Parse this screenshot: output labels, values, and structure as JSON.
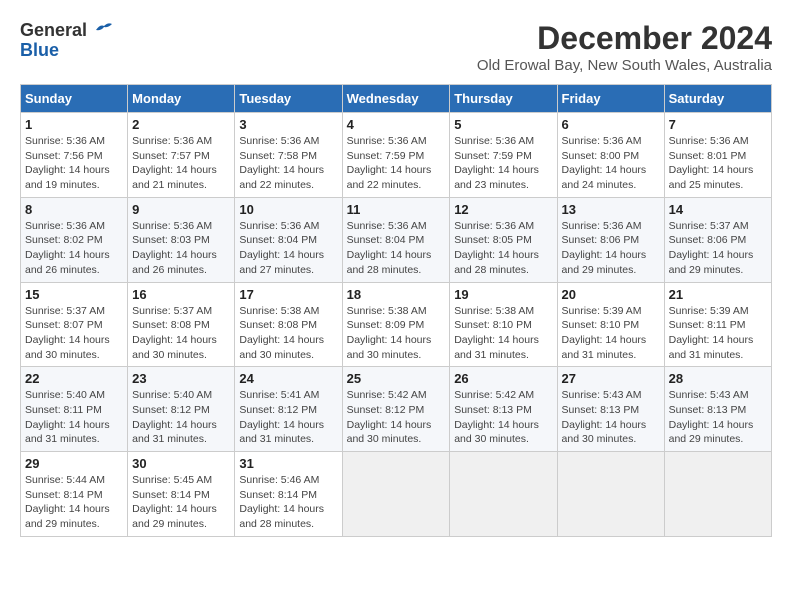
{
  "logo": {
    "line1": "General",
    "line2": "Blue"
  },
  "title": "December 2024",
  "subtitle": "Old Erowal Bay, New South Wales, Australia",
  "days_of_week": [
    "Sunday",
    "Monday",
    "Tuesday",
    "Wednesday",
    "Thursday",
    "Friday",
    "Saturday"
  ],
  "weeks": [
    [
      {
        "day": "1",
        "info": "Sunrise: 5:36 AM\nSunset: 7:56 PM\nDaylight: 14 hours\nand 19 minutes."
      },
      {
        "day": "2",
        "info": "Sunrise: 5:36 AM\nSunset: 7:57 PM\nDaylight: 14 hours\nand 21 minutes."
      },
      {
        "day": "3",
        "info": "Sunrise: 5:36 AM\nSunset: 7:58 PM\nDaylight: 14 hours\nand 22 minutes."
      },
      {
        "day": "4",
        "info": "Sunrise: 5:36 AM\nSunset: 7:59 PM\nDaylight: 14 hours\nand 22 minutes."
      },
      {
        "day": "5",
        "info": "Sunrise: 5:36 AM\nSunset: 7:59 PM\nDaylight: 14 hours\nand 23 minutes."
      },
      {
        "day": "6",
        "info": "Sunrise: 5:36 AM\nSunset: 8:00 PM\nDaylight: 14 hours\nand 24 minutes."
      },
      {
        "day": "7",
        "info": "Sunrise: 5:36 AM\nSunset: 8:01 PM\nDaylight: 14 hours\nand 25 minutes."
      }
    ],
    [
      {
        "day": "8",
        "info": "Sunrise: 5:36 AM\nSunset: 8:02 PM\nDaylight: 14 hours\nand 26 minutes."
      },
      {
        "day": "9",
        "info": "Sunrise: 5:36 AM\nSunset: 8:03 PM\nDaylight: 14 hours\nand 26 minutes."
      },
      {
        "day": "10",
        "info": "Sunrise: 5:36 AM\nSunset: 8:04 PM\nDaylight: 14 hours\nand 27 minutes."
      },
      {
        "day": "11",
        "info": "Sunrise: 5:36 AM\nSunset: 8:04 PM\nDaylight: 14 hours\nand 28 minutes."
      },
      {
        "day": "12",
        "info": "Sunrise: 5:36 AM\nSunset: 8:05 PM\nDaylight: 14 hours\nand 28 minutes."
      },
      {
        "day": "13",
        "info": "Sunrise: 5:36 AM\nSunset: 8:06 PM\nDaylight: 14 hours\nand 29 minutes."
      },
      {
        "day": "14",
        "info": "Sunrise: 5:37 AM\nSunset: 8:06 PM\nDaylight: 14 hours\nand 29 minutes."
      }
    ],
    [
      {
        "day": "15",
        "info": "Sunrise: 5:37 AM\nSunset: 8:07 PM\nDaylight: 14 hours\nand 30 minutes."
      },
      {
        "day": "16",
        "info": "Sunrise: 5:37 AM\nSunset: 8:08 PM\nDaylight: 14 hours\nand 30 minutes."
      },
      {
        "day": "17",
        "info": "Sunrise: 5:38 AM\nSunset: 8:08 PM\nDaylight: 14 hours\nand 30 minutes."
      },
      {
        "day": "18",
        "info": "Sunrise: 5:38 AM\nSunset: 8:09 PM\nDaylight: 14 hours\nand 30 minutes."
      },
      {
        "day": "19",
        "info": "Sunrise: 5:38 AM\nSunset: 8:10 PM\nDaylight: 14 hours\nand 31 minutes."
      },
      {
        "day": "20",
        "info": "Sunrise: 5:39 AM\nSunset: 8:10 PM\nDaylight: 14 hours\nand 31 minutes."
      },
      {
        "day": "21",
        "info": "Sunrise: 5:39 AM\nSunset: 8:11 PM\nDaylight: 14 hours\nand 31 minutes."
      }
    ],
    [
      {
        "day": "22",
        "info": "Sunrise: 5:40 AM\nSunset: 8:11 PM\nDaylight: 14 hours\nand 31 minutes."
      },
      {
        "day": "23",
        "info": "Sunrise: 5:40 AM\nSunset: 8:12 PM\nDaylight: 14 hours\nand 31 minutes."
      },
      {
        "day": "24",
        "info": "Sunrise: 5:41 AM\nSunset: 8:12 PM\nDaylight: 14 hours\nand 31 minutes."
      },
      {
        "day": "25",
        "info": "Sunrise: 5:42 AM\nSunset: 8:12 PM\nDaylight: 14 hours\nand 30 minutes."
      },
      {
        "day": "26",
        "info": "Sunrise: 5:42 AM\nSunset: 8:13 PM\nDaylight: 14 hours\nand 30 minutes."
      },
      {
        "day": "27",
        "info": "Sunrise: 5:43 AM\nSunset: 8:13 PM\nDaylight: 14 hours\nand 30 minutes."
      },
      {
        "day": "28",
        "info": "Sunrise: 5:43 AM\nSunset: 8:13 PM\nDaylight: 14 hours\nand 29 minutes."
      }
    ],
    [
      {
        "day": "29",
        "info": "Sunrise: 5:44 AM\nSunset: 8:14 PM\nDaylight: 14 hours\nand 29 minutes."
      },
      {
        "day": "30",
        "info": "Sunrise: 5:45 AM\nSunset: 8:14 PM\nDaylight: 14 hours\nand 29 minutes."
      },
      {
        "day": "31",
        "info": "Sunrise: 5:46 AM\nSunset: 8:14 PM\nDaylight: 14 hours\nand 28 minutes."
      },
      {
        "day": "",
        "info": ""
      },
      {
        "day": "",
        "info": ""
      },
      {
        "day": "",
        "info": ""
      },
      {
        "day": "",
        "info": ""
      }
    ]
  ]
}
